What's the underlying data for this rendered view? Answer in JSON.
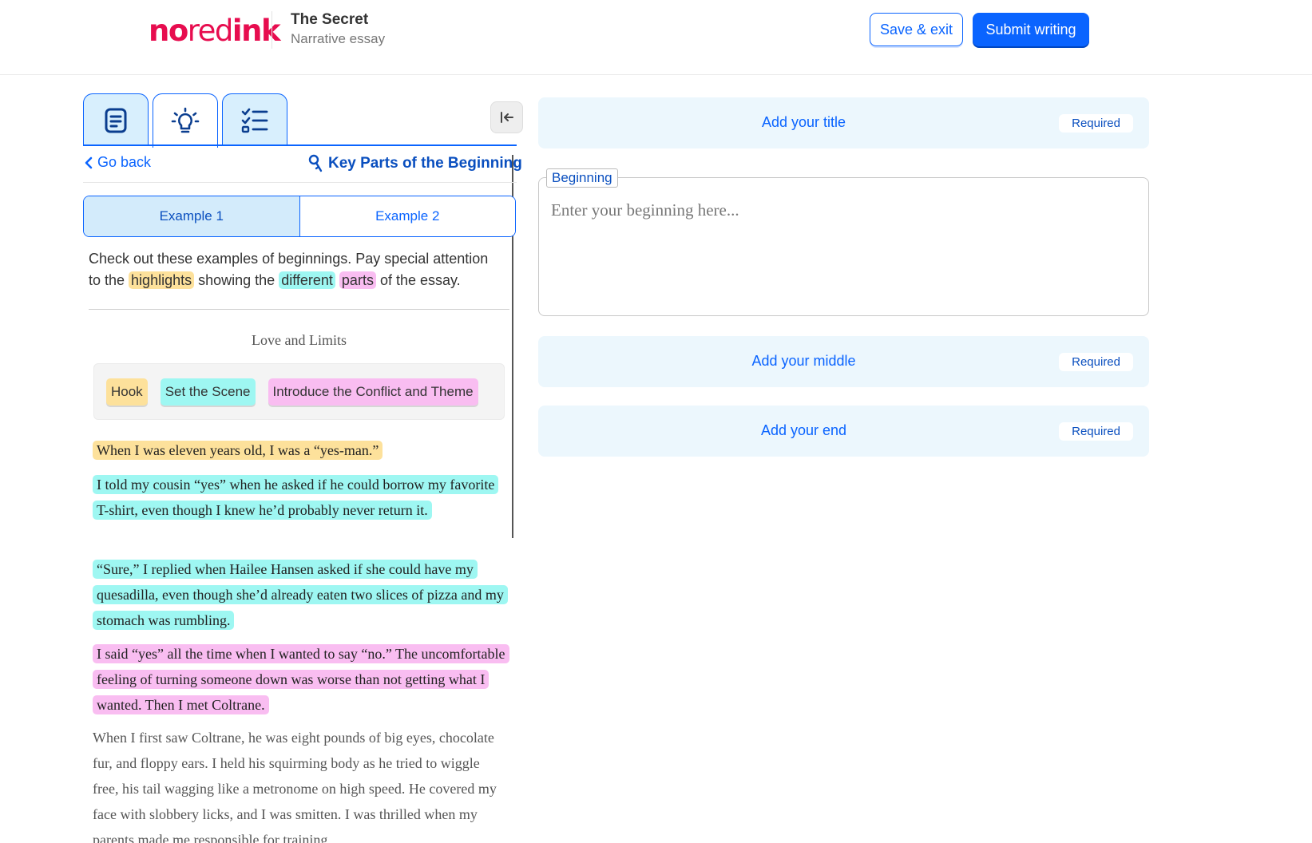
{
  "header": {
    "logo": {
      "part1": "no",
      "part2": "red",
      "part3": "ink"
    },
    "title": "The Secret",
    "subtitle": "Narrative essay",
    "save_label": "Save & exit",
    "submit_label": "Submit writing"
  },
  "colors": {
    "brand_red": "#e70d4f",
    "accent_blue": "#0a64ff",
    "hook": "#fde19b",
    "scene": "#9ef7f2",
    "conflict": "#f9bdf1"
  },
  "sidebar": {
    "tabs": [
      {
        "icon": "document-icon",
        "active": false
      },
      {
        "icon": "lightbulb-icon",
        "active": true
      },
      {
        "icon": "checklist-icon",
        "active": false
      }
    ],
    "go_back": "Go back",
    "section_title": "Key Parts of the Beginning",
    "examples": [
      "Example 1",
      "Example 2"
    ],
    "intro": {
      "text1": "Check out these examples of beginnings. Pay special attention to the ",
      "hl1": "highlights",
      "text2": " showing the ",
      "hl2": "different",
      "hl3": "parts",
      "text3": " of the essay."
    },
    "essay_title": "Love and Limits",
    "legend": [
      "Hook",
      "Set the Scene",
      "Introduce the Conflict and Theme"
    ],
    "paragraphs": {
      "hook": "When I was eleven years old, I was a “yes-man.”",
      "scene1": "I told my cousin “yes” when he asked if he could borrow my favorite T-shirt, even though I knew he’d probably never return it.",
      "scene2": "“Sure,” I replied when Hailee Hansen asked if she could have my quesadilla, even though she’d already eaten two slices of pizza and my stomach was rumbling.",
      "conflict": "I said “yes” all the time when I wanted to say “no.” The uncomfortable feeling of turning someone down was worse than not getting what I wanted. Then I met Coltrane.",
      "plain": "When I first saw Coltrane, he was eight pounds of big eyes, chocolate fur, and floppy ears. I held his squirming body as he tried to wiggle free, his tail wagging like a metronome on high speed. He covered my face with slobbery licks, and I was smitten. I was thrilled when my parents made me responsible for training"
    }
  },
  "editor": {
    "title_label": "Add your title",
    "beginning_label": "Beginning",
    "beginning_placeholder": "Enter your beginning here...",
    "middle_label": "Add your middle",
    "end_label": "Add your end",
    "required": "Required"
  }
}
